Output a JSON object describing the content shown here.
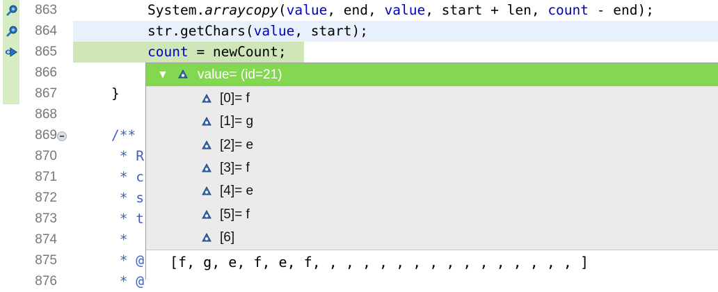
{
  "editor": {
    "lines": [
      {
        "num": "863",
        "segments": [
          {
            "t": "System.",
            "c": ""
          },
          {
            "t": "arraycopy",
            "c": "it"
          },
          {
            "t": "(",
            "c": ""
          },
          {
            "t": "value",
            "c": "fld"
          },
          {
            "t": ", end, ",
            "c": ""
          },
          {
            "t": "value",
            "c": "fld"
          },
          {
            "t": ", start + len, ",
            "c": ""
          },
          {
            "t": "count",
            "c": "fld"
          },
          {
            "t": " - end);",
            "c": ""
          }
        ],
        "indent": 3
      },
      {
        "num": "864",
        "segments": [
          {
            "t": "str.getChars(",
            "c": ""
          },
          {
            "t": "value",
            "c": "fld"
          },
          {
            "t": ", start);",
            "c": ""
          }
        ],
        "indent": 3
      },
      {
        "num": "865",
        "segments": [
          {
            "t": "count",
            "c": "fld"
          },
          {
            "t": " = newCount;",
            "c": ""
          }
        ],
        "indent": 3
      },
      {
        "num": "866",
        "segments": [],
        "indent": 0
      },
      {
        "num": "867",
        "segments": [
          {
            "t": "}",
            "c": ""
          }
        ],
        "indent": 0
      },
      {
        "num": "868",
        "segments": [],
        "indent": 0
      },
      {
        "num": "869",
        "segments": [
          {
            "t": "/**",
            "c": "cm"
          }
        ],
        "indent": 0
      },
      {
        "num": "870",
        "segments": [
          {
            "t": " * R",
            "c": "cm"
          }
        ],
        "indent": 0
      },
      {
        "num": "871",
        "segments": [
          {
            "t": " * c",
            "c": "cm"
          }
        ],
        "indent": 0
      },
      {
        "num": "872",
        "segments": [
          {
            "t": " * s",
            "c": "cm"
          }
        ],
        "indent": 0
      },
      {
        "num": "873",
        "segments": [
          {
            "t": " * t",
            "c": "cm"
          }
        ],
        "indent": 0
      },
      {
        "num": "874",
        "segments": [
          {
            "t": " *",
            "c": "cm"
          }
        ],
        "indent": 0
      },
      {
        "num": "875",
        "segments": [
          {
            "t": " * @",
            "c": "cm"
          }
        ],
        "indent": 0
      },
      {
        "num": "876",
        "segments": [
          {
            "t": " * @",
            "c": "cm"
          }
        ],
        "indent": 0
      }
    ]
  },
  "popup": {
    "root_label": "value= (id=21)",
    "children": [
      "[0]= f",
      "[1]= g",
      "[2]= e",
      "[3]= f",
      "[4]= e",
      "[5]= f",
      "[6]"
    ],
    "detail": "[f, g, e, f, e, f, , , , , , , , , , , , , , , , ]"
  },
  "colors": {
    "selection": "#84d750",
    "current_line": "#cfe6b8",
    "keyword": "#7f0055",
    "field": "#0000c0",
    "comment": "#3f5fbf"
  }
}
